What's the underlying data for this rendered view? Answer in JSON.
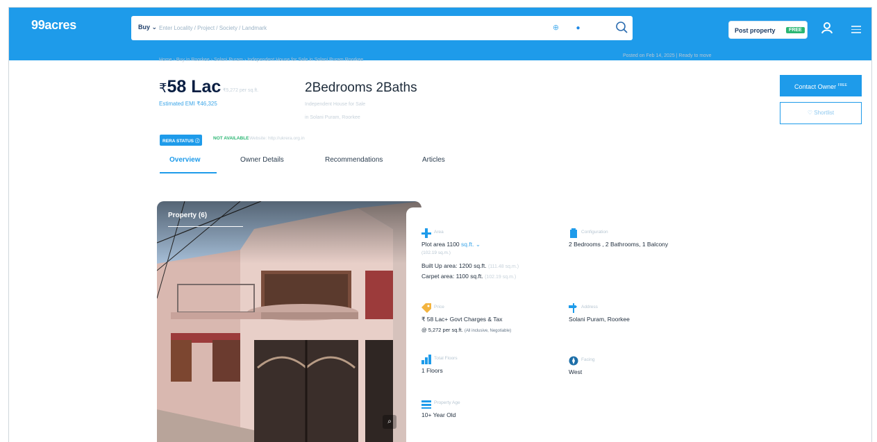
{
  "header": {
    "logo": "99acres",
    "buy_label": "Buy",
    "search_placeholder": "Enter Locality / Project / Society / Landmark",
    "post_property_label": "Post property",
    "post_free_badge": "FREE"
  },
  "crumbs": "Home › Buy in Roorkee › Solani Puram › Independent House for Sale in Solani Puram Roorkee",
  "posted": "Posted on Feb 14, 2025  |  Ready to move",
  "listing": {
    "price_symbol": "₹",
    "price": "58 Lac",
    "price_sub": "₹5,272 per sq.ft.",
    "emi": "Estimated EMI ₹46,325",
    "title": "2Bedrooms 2Baths",
    "address_line1": "Independent House for Sale",
    "address_line2": "in Solani Puram, Roorkee"
  },
  "actions": {
    "contact_label": "Contact Owner",
    "contact_badge": "FREE",
    "shortlist_label": "Shortlist"
  },
  "rera": {
    "status_label": "RERA STATUS",
    "value": "NOT AVAILABLE",
    "website": "Website: http://ukrera.org.in"
  },
  "tabs": [
    {
      "label": "Overview"
    },
    {
      "label": "Owner Details"
    },
    {
      "label": "Recommendations"
    },
    {
      "label": "Articles"
    }
  ],
  "gallery": {
    "label": "Property (6)"
  },
  "details": {
    "area": {
      "label": "Area",
      "plot": "Plot area 1100",
      "unit": "sq.ft.",
      "sub_label": "(102.19 sq.m.)",
      "built_up": "Built Up area: 1200 sq.ft.",
      "built_up_m": "(111.48 sq.m.)",
      "carpet": "Carpet area: 1100 sq.ft.",
      "carpet_m": "(102.19 sq.m.)"
    },
    "config": {
      "label": "Configuration",
      "value": "2 Bedrooms , 2 Bathrooms, 1 Balcony"
    },
    "price": {
      "label": "Price",
      "value": "₹ 58 Lac+ Govt Charges & Tax",
      "per_sqft": "@ 5,272 per sq.ft.",
      "note": "(All inclusive, Negotiable)"
    },
    "address": {
      "label": "Address",
      "value": "Solani Puram, Roorkee"
    },
    "floors": {
      "label": "Total Floors",
      "value": "1 Floors"
    },
    "facing": {
      "label": "Facing",
      "value": "West"
    },
    "age": {
      "label": "Property Age",
      "value": "10+ Year Old"
    }
  }
}
